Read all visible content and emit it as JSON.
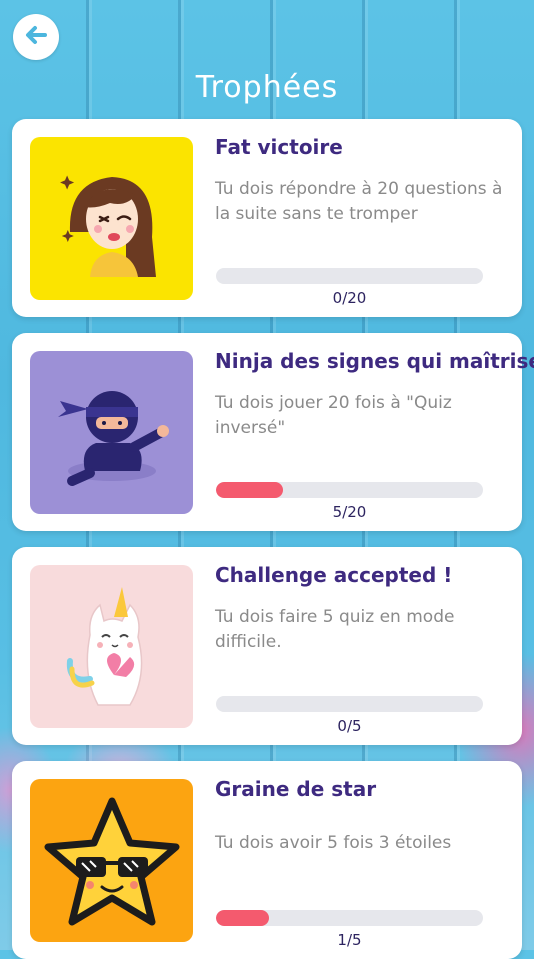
{
  "header": {
    "title": "Trophées",
    "back_icon": "arrow-left-icon"
  },
  "colors": {
    "title_purple": "#3e2a80",
    "progress_fill": "#f45a6e",
    "progress_track": "#e6e7ec"
  },
  "trophies": [
    {
      "title": "Fat victoire",
      "description": "Tu dois répondre à 20 questions à la suite sans te tromper",
      "progress_text": "0/20",
      "progress": 0,
      "image": "girl-laughing-illustration",
      "image_bg": "#fbe400"
    },
    {
      "title": "Ninja des signes qui maîtrise",
      "description": "Tu dois jouer 20 fois à \"Quiz inversé\"",
      "progress_text": "5/20",
      "progress": 0.25,
      "image": "ninja-illustration",
      "image_bg": "#9c90d6"
    },
    {
      "title": "Challenge accepted !",
      "description": "Tu dois faire 5 quiz en mode difficile.",
      "progress_text": "0/5",
      "progress": 0,
      "image": "unicorn-cat-illustration",
      "image_bg": "#f8dbdc"
    },
    {
      "title": "Graine de star",
      "description": "Tu dois avoir 5 fois 3 étoiles",
      "progress_text": "1/5",
      "progress": 0.2,
      "image": "star-sunglasses-illustration",
      "image_bg": "#fca411"
    }
  ]
}
